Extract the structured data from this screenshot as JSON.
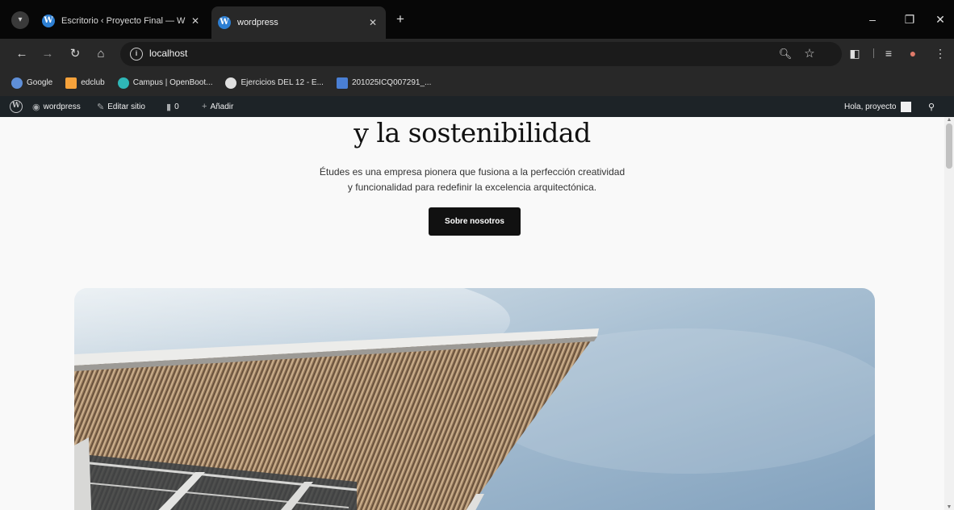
{
  "browser": {
    "tabs": [
      {
        "title": "Escritorio ‹ Proyecto Final — W",
        "close": "✕",
        "active": false
      },
      {
        "title": "wordpress",
        "close": "✕",
        "active": true
      }
    ],
    "new_tab": "+",
    "url": "localhost",
    "icons": {
      "tab_search": "chevron-down-icon",
      "back": "back-arrow-icon",
      "forward": "forward-arrow-icon",
      "reload": "reload-icon",
      "home": "home-icon",
      "site_info": "info-icon",
      "zoom": "zoom-icon",
      "bookmark_star": "star-icon",
      "extensions": "puzzle-icon",
      "media": "media-icon",
      "profile": "profile-icon",
      "menu": "kebab-menu-icon"
    }
  },
  "bookmarks": [
    {
      "label": "Google",
      "color": "#5f8fd8"
    },
    {
      "label": "edclub",
      "color": "#f6a23b"
    },
    {
      "label": "Campus | OpenBoot...",
      "color": "#2fb7b7"
    },
    {
      "label": "Ejercicios DEL 12 - E...",
      "color": "#e0e0e0"
    },
    {
      "label": "201025ICQ007291_...",
      "color": "#4a7fd4"
    }
  ],
  "adminbar": {
    "site": "wordpress",
    "edit": "Editar sitio",
    "comments": "0",
    "add": "Añadir",
    "greeting": "Hola, proyecto"
  },
  "page": {
    "title_line": "y la sostenibilidad",
    "description_1": "Études es una empresa pionera que fusiona a la perfección creatividad",
    "description_2": "y funcionalidad para redefinir la excelencia arquitectónica.",
    "button": "Sobre nosotros"
  },
  "colors": {
    "tab_strip": "#070707",
    "toolbar": "#282828",
    "adminbar": "#1d2327",
    "page_bg": "#f9f9f9",
    "button": "#111111"
  }
}
